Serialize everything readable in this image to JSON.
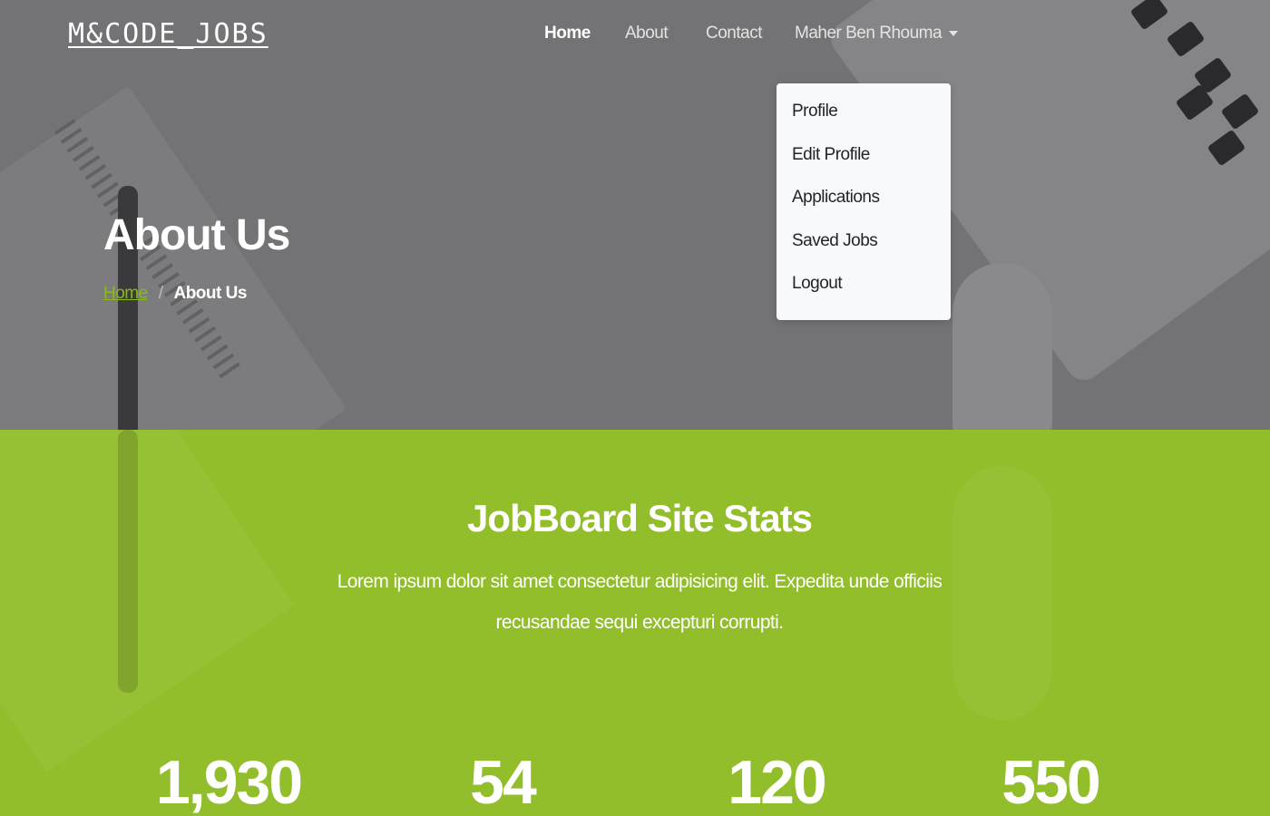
{
  "brand": {
    "logo": "M&CODE_JOBS"
  },
  "nav": {
    "items": [
      {
        "label": "Home",
        "active": true
      },
      {
        "label": "About",
        "active": false
      },
      {
        "label": "Contact",
        "active": false
      }
    ],
    "user_menu": {
      "label": "Maher Ben Rhouma",
      "items": [
        "Profile",
        "Edit Profile",
        "Applications",
        "Saved Jobs",
        "Logout"
      ]
    }
  },
  "hero": {
    "title": "About Us",
    "breadcrumb": {
      "home": "Home",
      "separator": "/",
      "current": "About Us"
    }
  },
  "stats": {
    "title": "JobBoard Site Stats",
    "description": "Lorem ipsum dolor sit amet consectetur adipisicing elit. Expedita unde officiis recusandae sequi excepturi corrupti.",
    "numbers": [
      "1,930",
      "54",
      "120",
      "550"
    ]
  },
  "colors": {
    "accent": "#89ba16",
    "stats_bg": "#92be2b",
    "hero_overlay": "#737375"
  }
}
